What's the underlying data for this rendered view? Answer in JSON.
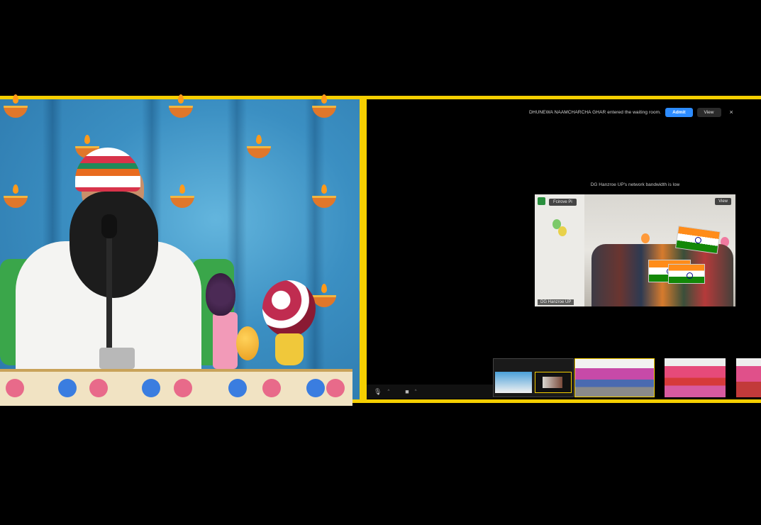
{
  "notification": {
    "text": "DHUNEWA NAAMCHARCHA GHAR entered the waiting room.",
    "admit_label": "Admit",
    "view_label": "View",
    "close_symbol": "×"
  },
  "bandwidth_notice": "DG Hanzroe UP's network bandwidth is low",
  "active_video": {
    "name_tag": "Fcirove Pi",
    "view_label": "View",
    "bottom_label": "DG Hanzroe UP"
  },
  "toolbar": {
    "mic_icon": "microphone-icon",
    "video_icon": "video-camera-icon"
  },
  "colors": {
    "frame_border": "#f5cf00",
    "admit": "#2d8cff",
    "background": "#000000"
  }
}
